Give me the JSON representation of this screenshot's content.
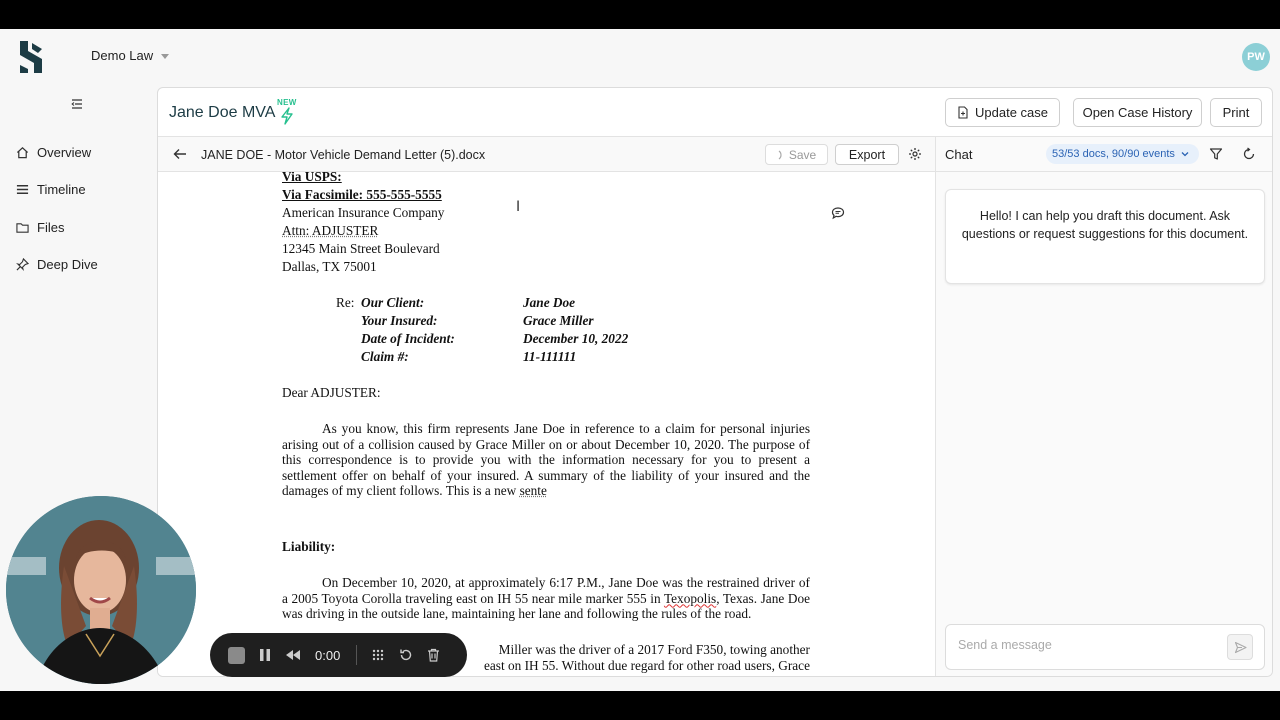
{
  "org": {
    "name": "Demo Law"
  },
  "user": {
    "initials": "PW"
  },
  "sidebar": {
    "items": [
      {
        "label": "Overview",
        "icon": "home-icon"
      },
      {
        "label": "Timeline",
        "icon": "list-icon"
      },
      {
        "label": "Files",
        "icon": "folder-icon"
      },
      {
        "label": "Deep Dive",
        "icon": "pin-icon"
      }
    ]
  },
  "case": {
    "title": "Jane Doe MVA",
    "badge": "NEW",
    "buttons": {
      "update": "Update case",
      "history": "Open Case History",
      "print": "Print"
    }
  },
  "document": {
    "filename": "JANE DOE - Motor Vehicle Demand Letter (5).docx",
    "save_label": "Save",
    "export_label": "Export",
    "address_lines": [
      "Via USPS:",
      "Via Facsimile: 555-555-5555",
      "American Insurance Company",
      "Attn: ADJUSTER",
      "12345 Main Street Boulevard",
      "Dallas, TX 75001"
    ],
    "re_label": "Re:",
    "re_rows": [
      {
        "key": "Our Client:",
        "value": "Jane Doe"
      },
      {
        "key": "Your Insured:",
        "value": "Grace Miller"
      },
      {
        "key": "Date of Incident:",
        "value": "December 10, 2022"
      },
      {
        "key": "Claim #:",
        "value": "11-111111"
      }
    ],
    "salutation": "Dear ADJUSTER:",
    "paragraph1": "As you know, this firm represents Jane Doe in reference to a claim for personal injuries arising out of a collision caused by Grace Miller on or about December 10, 2020. The purpose of this correspondence is to provide you with the information necessary for you to present a settlement offer on behalf of your insured. A summary of the liability of your insured and the damages of my client follows. This is a new ",
    "paragraph1_tail": "sente",
    "liability_heading": "Liability:",
    "paragraph2_a": "On December 10, 2020, at approximately 6:17 P.M., Jane Doe was the restrained driver of a 2005 Toyota Corolla traveling east on IH 55 near mile marker 555 in ",
    "paragraph2_place": "Texopolis",
    "paragraph2_b": ", Texas. Jane Doe was driving in the outside lane, maintaining her lane and following the rules of the road.",
    "paragraph3_line1": "Miller was the driver of a 2017 Ford F350, towing another",
    "paragraph3_line2": "east on IH 55. Without due regard for other road users, Grace"
  },
  "chat": {
    "title": "Chat",
    "docs_filter": "53/53 docs, 90/90 events",
    "assistant_message": "Hello! I can help you draft this document. Ask questions or request suggestions for this document.",
    "input_placeholder": "Send a message"
  },
  "recorder": {
    "time": "0:00"
  },
  "colors": {
    "brand": "#1d3c45",
    "badge": "#27c08f",
    "pill_bg": "#e7f0fb",
    "pill_text": "#2b63b4"
  }
}
